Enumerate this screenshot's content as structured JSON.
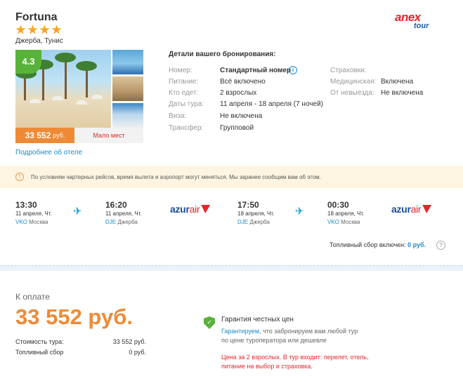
{
  "hotel": {
    "name": "Fortuna",
    "stars": 4,
    "location": "Джерба, Тунис",
    "rating": "4.3",
    "price": "33 552",
    "currency": "руб.",
    "availability": "Мало мест",
    "details_link": "Подробнее об отеле"
  },
  "operator": {
    "logo_main": "anex",
    "logo_sub": "tour"
  },
  "booking": {
    "title": "Детали вашего бронирования:",
    "rows": [
      {
        "label": "Номер:",
        "value": "Стандартный номер"
      },
      {
        "label": "Питание:",
        "value": "Всё включено"
      },
      {
        "label": "Кто едет:",
        "value": "2 взрослых"
      },
      {
        "label": "Даты тура:",
        "value": "11 апреля - 18 апреля (7 ночей)"
      },
      {
        "label": "Виза:",
        "value": "Не включена"
      },
      {
        "label": "Трансфер:",
        "value": "Групповой"
      }
    ],
    "insurance_title": "Страховки:",
    "insurance": [
      {
        "label": "Медицинская:",
        "value": "Включена"
      },
      {
        "label": "От невыезда:",
        "value": "Не включена"
      }
    ]
  },
  "notice": "По условиям чартерных рейсов, время вылета и аэропорт могут меняться. Мы заранее сообщим вам об этом.",
  "flights": [
    {
      "depart": {
        "time": "13:30",
        "date": "11 апреля, Чт.",
        "code": "VKO",
        "city": "Москва"
      },
      "arrive": {
        "time": "16:20",
        "date": "11 апреля, Чт.",
        "code": "DJE",
        "city": "Джерба"
      },
      "airline": {
        "name": "azur",
        "suffix": "air"
      }
    },
    {
      "depart": {
        "time": "17:50",
        "date": "18 апреля, Чт.",
        "code": "DJE",
        "city": "Джерба"
      },
      "arrive": {
        "time": "00:30",
        "date": "18 апреля, Чт.",
        "code": "VKO",
        "city": "Москва"
      },
      "airline": {
        "name": "azur",
        "suffix": "air"
      }
    }
  ],
  "fuel": {
    "label": "Топливный сбор включен:",
    "value": "0 руб.",
    "help": "?"
  },
  "payment": {
    "label": "К оплате",
    "total": "33 552 руб.",
    "lines": [
      {
        "label": "Стоимость тура:",
        "value": "33 552 руб."
      },
      {
        "label": "Топливный сбор",
        "value": "0 руб."
      }
    ]
  },
  "guarantee": {
    "title": "Гарантия честных цен",
    "link": "Гарантируем",
    "text": ", что забронируем вам любой тур по цене туроператора или дешевле",
    "price_note": "Цена за 2 взрослых. В тур входит: перелет, отель, питание на выбор и страховка."
  },
  "colors": {
    "accent": "#ee8a36",
    "link": "#1a8ac9",
    "rating": "#59b23a",
    "alert": "#e3262b"
  }
}
